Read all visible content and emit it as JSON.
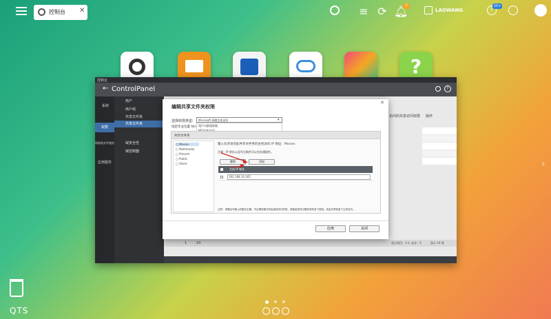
{
  "taskbar": {
    "app_tab": "控制台",
    "user": "LAOWANG",
    "notifications_badge": "7",
    "updates_badge": "10+"
  },
  "desktop": {
    "icons": [
      "settings-icon",
      "folder-icon",
      "storage-icon",
      "cloud-icon",
      "app-center-icon",
      "help-icon"
    ],
    "trash_name": "trash-icon",
    "qts": "QTS"
  },
  "window": {
    "title": "控制台",
    "app_title": "ControlPanel",
    "nav": [
      "系统",
      "权限",
      "网络和文件服务",
      "应用服务"
    ],
    "menu": [
      "用户",
      "用户组",
      "共享文件夹",
      "域安全性",
      "域控制器"
    ],
    "right_header": "操作",
    "right_col": "访问的共享访问权限",
    "footer_left": "1",
    "footer_mid": "10",
    "footer_page": "显示项目：1-5, 总计：5",
    "footer_show": "显示 10 项"
  },
  "dialog": {
    "title": "编辑共享文件夹权限",
    "type_label": "选择权限类型:",
    "type_value": "Microsoft 网络主机访问",
    "options": [
      "用户与群组权限",
      "NFS主机访问",
      "Microsoft 网络主机访问"
    ],
    "share_label": "指定作业位置 Movies",
    "panel_header": "共享文件夹",
    "tree": [
      "Movies",
      "Multimedia",
      "Present",
      "Public",
      "Share"
    ],
    "host_desc": "输入允许访问此共享文件夹的主机访问 IP 地址：Movies",
    "note_top": "注意：IP 地址以逗号分隔并可以包含通配符。",
    "delete_btn": "删除",
    "add_btn": "添加",
    "table_col": "主机 IP 地址",
    "ip_value": "192.168.10.165",
    "note_bottom": "注意：请确定写输入的格式正确。不正确的格式将会造成访问失败。请使用逗号分隔并带有多个规则。将会共享到某个主机访问。",
    "apply": "应用",
    "cancel": "关闭"
  }
}
